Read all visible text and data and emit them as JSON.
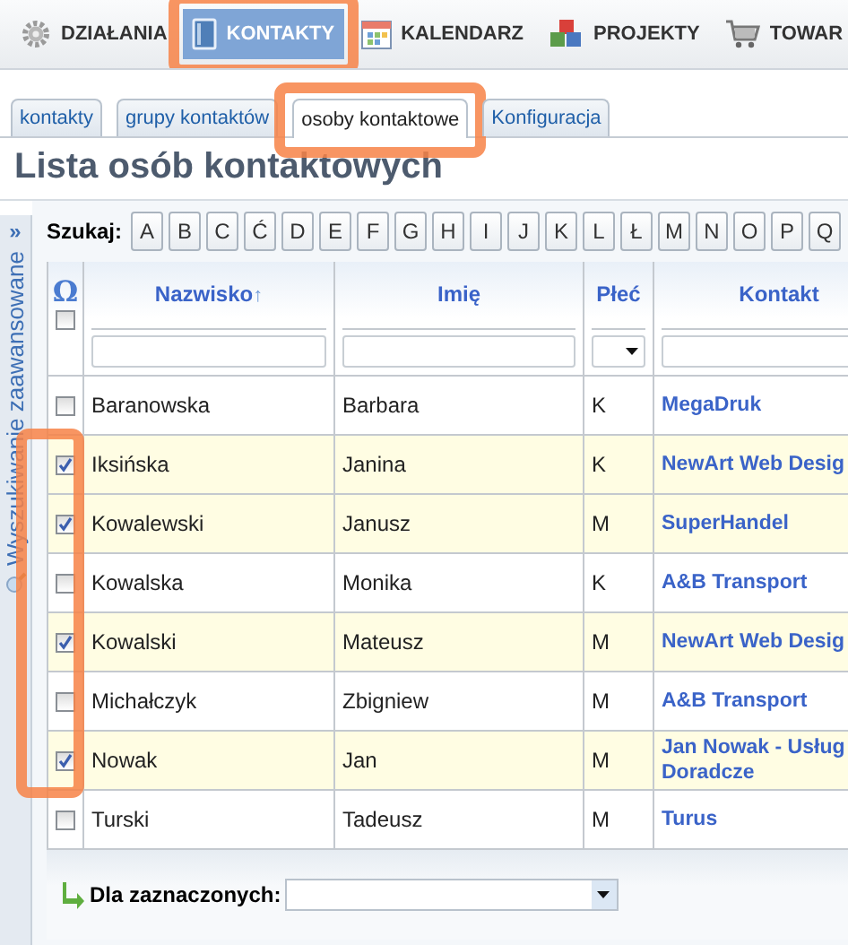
{
  "nav": [
    {
      "label": "DZIAŁANIA",
      "selected": false,
      "highlighted": false
    },
    {
      "label": "KONTAKTY",
      "selected": true,
      "highlighted": true
    },
    {
      "label": "KALENDARZ",
      "selected": false,
      "highlighted": false
    },
    {
      "label": "PROJEKTY",
      "selected": false,
      "highlighted": false
    },
    {
      "label": "TOWAR",
      "selected": false,
      "highlighted": false
    }
  ],
  "tabs": [
    {
      "label": "kontakty",
      "selected": false,
      "highlighted": false
    },
    {
      "label": "grupy kontaktów",
      "selected": false,
      "highlighted": false
    },
    {
      "label": "osoby kontaktowe",
      "selected": true,
      "highlighted": true
    },
    {
      "label": "Konfiguracja",
      "selected": false,
      "highlighted": false
    }
  ],
  "title": "Lista osób kontaktowych",
  "sidebar": {
    "toggle": "»",
    "label": "Wyszukiwanie zaawansowane"
  },
  "search": {
    "label": "Szukaj:",
    "letters": [
      "A",
      "B",
      "C",
      "Ć",
      "D",
      "E",
      "F",
      "G",
      "H",
      "I",
      "J",
      "K",
      "L",
      "Ł",
      "M",
      "N",
      "O",
      "P",
      "Q"
    ]
  },
  "table": {
    "select_all": {
      "symbol": "Ω",
      "checked": false
    },
    "columns": [
      {
        "label": "Nazwisko",
        "sort_mark": "↑",
        "kind": "text"
      },
      {
        "label": "Imię",
        "kind": "text"
      },
      {
        "label": "Płeć",
        "kind": "select"
      },
      {
        "label": "Kontakt",
        "kind": "text"
      }
    ],
    "rows": [
      {
        "surname": "Baranowska",
        "first_name": "Barbara",
        "gender": "K",
        "contact": [
          "MegaDruk"
        ],
        "checked": false
      },
      {
        "surname": "Iksińska",
        "first_name": "Janina",
        "gender": "K",
        "contact": [
          "NewArt Web Desig"
        ],
        "checked": true
      },
      {
        "surname": "Kowalewski",
        "first_name": "Janusz",
        "gender": "M",
        "contact": [
          "SuperHandel"
        ],
        "checked": true
      },
      {
        "surname": "Kowalska",
        "first_name": "Monika",
        "gender": "K",
        "contact": [
          "A&B Transport"
        ],
        "checked": false
      },
      {
        "surname": "Kowalski",
        "first_name": "Mateusz",
        "gender": "M",
        "contact": [
          "NewArt Web Desig"
        ],
        "checked": true
      },
      {
        "surname": "Michałczyk",
        "first_name": "Zbigniew",
        "gender": "M",
        "contact": [
          "A&B Transport"
        ],
        "checked": false
      },
      {
        "surname": "Nowak",
        "first_name": "Jan",
        "gender": "M",
        "contact": [
          "Jan Nowak - Usług",
          "Doradcze"
        ],
        "checked": true
      },
      {
        "surname": "Turski",
        "first_name": "Tadeusz",
        "gender": "M",
        "contact": [
          "Turus"
        ],
        "checked": false
      }
    ],
    "checked_highlighted": true
  },
  "footer": {
    "label": "Dla zaznaczonych:"
  }
}
